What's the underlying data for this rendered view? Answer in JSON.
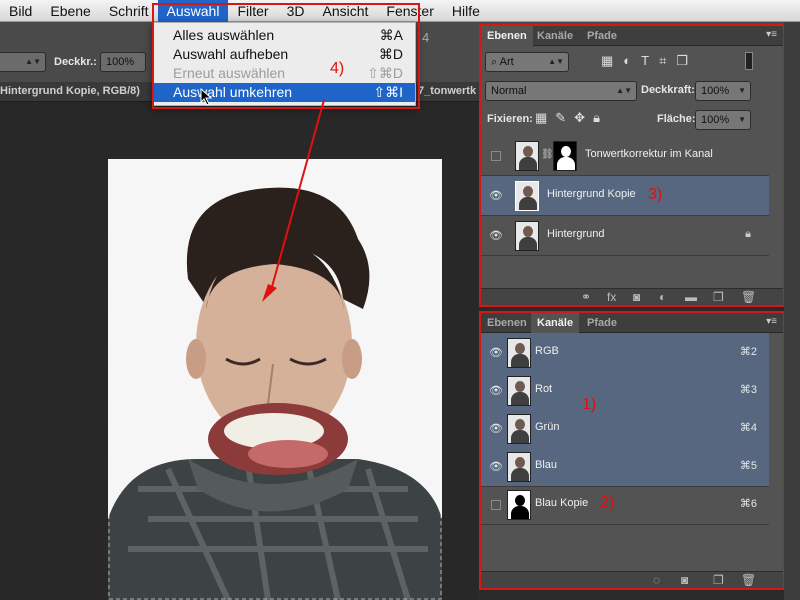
{
  "menubar": {
    "items": [
      "Bild",
      "Ebene",
      "Schrift",
      "Auswahl",
      "Filter",
      "3D",
      "Ansicht",
      "Fenster",
      "Hilfe"
    ],
    "active_index": 3
  },
  "options_bar": {
    "opacity_label": "Deckkr.:",
    "opacity_value": "100%",
    "stray_digit": "4"
  },
  "document": {
    "tab_title": "Hintergrund Kopie, RGB/8)",
    "tab_title_2": "7_tonwertk"
  },
  "dropdown": {
    "items": [
      {
        "label": "Alles auswählen",
        "shortcut": "⌘A",
        "disabled": false,
        "highlighted": false
      },
      {
        "label": "Auswahl aufheben",
        "shortcut": "⌘D",
        "disabled": false,
        "highlighted": false
      },
      {
        "label": "Erneut auswählen",
        "shortcut": "⇧⌘D",
        "disabled": true,
        "highlighted": false
      },
      {
        "label": "Auswahl umkehren",
        "shortcut": "⇧⌘I",
        "disabled": false,
        "highlighted": true
      }
    ]
  },
  "annotations": {
    "step1": "1)",
    "step2": "2)",
    "step3": "3)",
    "step4": "4)"
  },
  "layers_panel": {
    "tabs": [
      "Ebenen",
      "Kanäle",
      "Pfade"
    ],
    "active_tab": "Ebenen",
    "filter_label": "Art",
    "blend_mode": "Normal",
    "opacity_label": "Deckkraft:",
    "opacity_value": "100%",
    "lock_label": "Fixieren:",
    "fill_label": "Fläche:",
    "fill_value": "100%",
    "layers": [
      {
        "name": "Tonwertkorrektur im Kanal",
        "visible": false,
        "selected": false
      },
      {
        "name": "Hintergrund Kopie",
        "visible": true,
        "selected": true
      },
      {
        "name": "Hintergrund",
        "visible": true,
        "selected": false
      }
    ]
  },
  "channels_panel": {
    "tabs": [
      "Ebenen",
      "Kanäle",
      "Pfade"
    ],
    "active_tab": "Kanäle",
    "channels": [
      {
        "name": "RGB",
        "shortcut": "⌘2",
        "visible": true,
        "selected": true
      },
      {
        "name": "Rot",
        "shortcut": "⌘3",
        "visible": true,
        "selected": true
      },
      {
        "name": "Grün",
        "shortcut": "⌘4",
        "visible": true,
        "selected": true
      },
      {
        "name": "Blau",
        "shortcut": "⌘5",
        "visible": true,
        "selected": true
      },
      {
        "name": "Blau Kopie",
        "shortcut": "⌘6",
        "visible": false,
        "selected": false
      }
    ]
  },
  "colors": {
    "accent": "#1e64c9",
    "selection_row": "#56677f",
    "annotation_red": "#d41717"
  }
}
